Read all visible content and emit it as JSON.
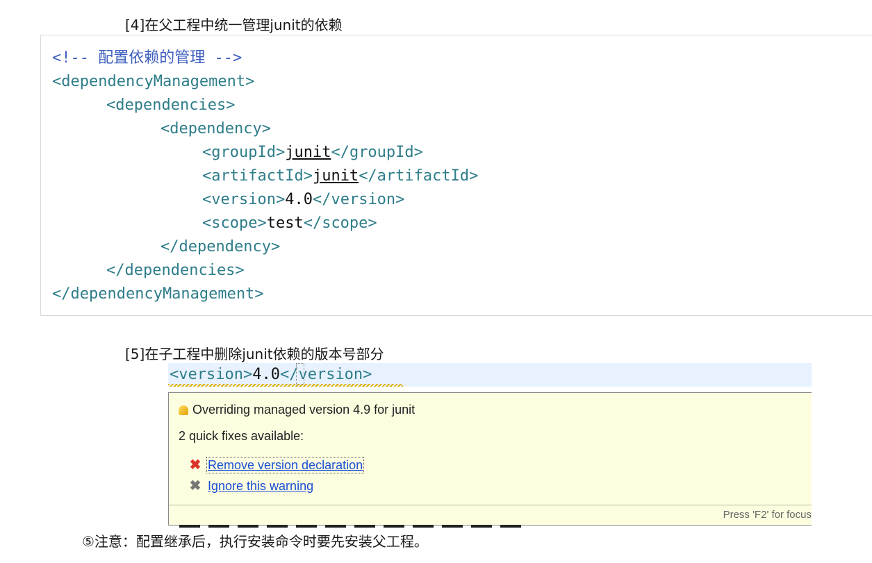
{
  "section4": {
    "heading": "[4]在父工程中统一管理junit的依赖"
  },
  "code": {
    "comment": "<!-- 配置依赖的管理 -->",
    "dm_open": "<dependencyManagement>",
    "deps_open": "<dependencies>",
    "dep_open": "<dependency>",
    "groupId_open": "<groupId>",
    "groupId_value": "junit",
    "groupId_close": "</groupId>",
    "artifactId_open": "<artifactId>",
    "artifactId_value": "junit",
    "artifactId_close": "</artifactId>",
    "version_open": "<version>",
    "version_value": "4.0",
    "version_close": "</version>",
    "scope_open": "<scope>",
    "scope_value": "test",
    "scope_close": "</scope>",
    "dep_close": "</dependency>",
    "deps_close": "</dependencies>",
    "dm_close": "</dependencyManagement>"
  },
  "section5": {
    "heading": "[5]在子工程中删除junit依赖的版本号部分",
    "snippet_open": "<version>",
    "snippet_value": "4.0",
    "snippet_close": "</version>"
  },
  "popup": {
    "title": "Overriding managed version 4.9 for junit",
    "count": "2 quick fixes available:",
    "fixes": [
      {
        "label": "Remove version declaration"
      },
      {
        "label": "Ignore this warning"
      }
    ],
    "footer": "Press 'F2' for focus"
  },
  "note": {
    "text": "⑤注意：配置继承后，执行安装命令时要先安装父工程。"
  },
  "icons": {
    "warning": "lightbulb-warning-icon",
    "fix_remove": "red-x-icon",
    "fix_ignore": "gray-x-icon"
  },
  "colors": {
    "tag": "#2e7d8a",
    "comment": "#3f5fbf",
    "popup_bg": "#fdfde0",
    "link": "#1a4fd6"
  }
}
